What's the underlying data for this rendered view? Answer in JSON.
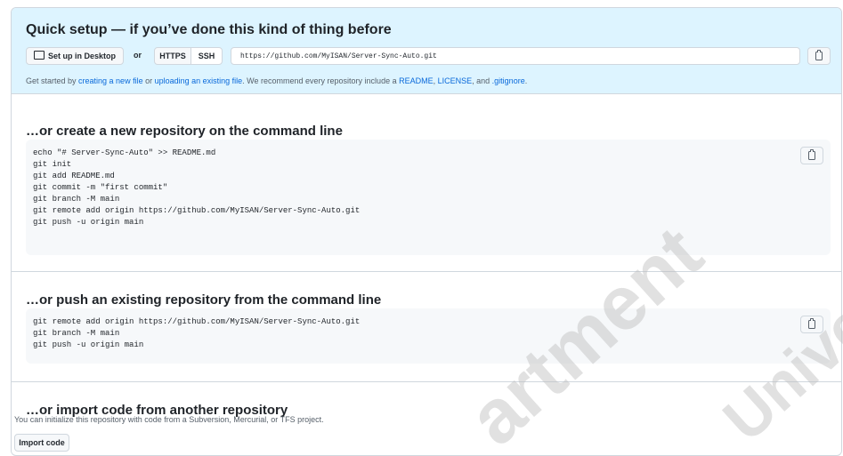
{
  "quick_setup": {
    "title": "Quick setup — if you’ve done this kind of thing before",
    "desktop_button": "Set up in Desktop",
    "or": "or",
    "https": "HTTPS",
    "ssh": "SSH",
    "clone_url": "https://github.com/MyISAN/Server-Sync-Auto.git",
    "help": {
      "prefix": "Get started by ",
      "new_file": "creating a new file",
      "or": " or ",
      "upload": "uploading an existing file",
      "middle": ". We recommend every repository include a ",
      "readme": "README",
      "comma1": ", ",
      "license": "LICENSE",
      "and": ", and ",
      "gitignore": ".gitignore",
      "end": "."
    }
  },
  "new_repo": {
    "title": "…or create a new repository on the command line",
    "code": "echo \"# Server-Sync-Auto\" >> README.md\ngit init\ngit add README.md\ngit commit -m \"first commit\"\ngit branch -M main\ngit remote add origin https://github.com/MyISAN/Server-Sync-Auto.git\ngit push -u origin main"
  },
  "push_existing": {
    "title": "…or push an existing repository from the command line",
    "code": "git remote add origin https://github.com/MyISAN/Server-Sync-Auto.git\ngit branch -M main\ngit push -u origin main"
  },
  "import": {
    "title": "…or import code from another repository",
    "description": "You can initialize this repository with code from a Subversion, Mercurial, or TFS project.",
    "button": "Import code"
  },
  "watermark": {
    "text1": "artment",
    "text2": "Unive"
  },
  "colors": {
    "accent_link": "#0969da",
    "quick_bg": "#ddf4ff",
    "code_bg": "#f6f8fa"
  },
  "icons": [
    "desktop-icon",
    "copy-icon"
  ]
}
